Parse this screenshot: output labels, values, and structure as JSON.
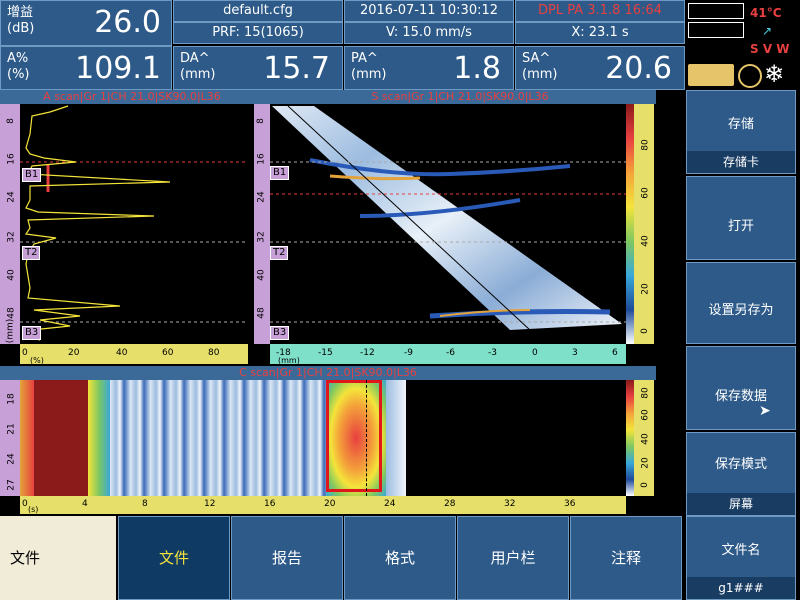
{
  "header": {
    "gain_label": "增益\n(dB)",
    "gain_value": "26.0",
    "file_name": "default.cfg",
    "prf": "PRF: 15(1065)",
    "datetime": "2016-07-11 10:30:12",
    "velocity": "V: 15.0 mm/s",
    "version": "DPL PA 3.1.8  16:64",
    "position": "X: 23.1  s",
    "amp_label": "A%\n(%)",
    "amp_value": "109.1",
    "da_label": "DA^\n(mm)",
    "da_value": "15.7",
    "pa_label": "PA^\n(mm)",
    "pa_value": "1.8",
    "sa_label": "SA^\n(mm)",
    "sa_value": "20.6"
  },
  "status": {
    "temperature": "41°C",
    "svw": "S V W"
  },
  "panels": {
    "ascan_title": "A scan|Gr 1|CH 21.0|SK90.0|L36",
    "sscan_title": "S scan|Gr 1|CH 21.0|SK90.0|L36",
    "cscan_title": "C scan|Gr 1|CH 21.0|SK90.0|L36",
    "unit_mm": "(mm)",
    "unit_pct": "(%)",
    "unit_s": "(s)",
    "marker_b1": "B1",
    "marker_t2": "T2",
    "marker_b3": "B3"
  },
  "ascan_y_ticks": [
    "8",
    "16",
    "24",
    "32",
    "40",
    "48"
  ],
  "ascan_x_ticks": [
    "0",
    "20",
    "40",
    "60",
    "80"
  ],
  "sscan_x_ticks": [
    "-18",
    "-15",
    "-12",
    "-9",
    "-6",
    "-3",
    "0",
    "3",
    "6"
  ],
  "sscan_y_ticks": [
    "8",
    "16",
    "24",
    "32",
    "40",
    "48"
  ],
  "sscan_color_ticks": [
    "80",
    "60",
    "40",
    "20",
    "0"
  ],
  "cscan_y_ticks": [
    "18",
    "21",
    "24",
    "27"
  ],
  "cscan_x_ticks": [
    "0",
    "4",
    "8",
    "12",
    "16",
    "20",
    "24",
    "28",
    "32",
    "36"
  ],
  "cscan_color_ticks": [
    "80",
    "60",
    "40",
    "20",
    "0"
  ],
  "side_menu": [
    {
      "label": "存储",
      "sub": "存储卡"
    },
    {
      "label": "打开",
      "sub": ""
    },
    {
      "label": "设置另存为",
      "sub": ""
    },
    {
      "label": "保存数据",
      "sub": ""
    },
    {
      "label": "保存模式",
      "sub": "屏幕"
    },
    {
      "label": "文件名",
      "sub": "g1###"
    }
  ],
  "bottom_tabs": {
    "menu_label": "文件",
    "tabs": [
      "文件",
      "报告",
      "格式",
      "用户栏",
      "注释"
    ]
  },
  "colors": {
    "header_bg": "#2d5a88",
    "active_tab": "#0f3a64",
    "active_tab_text": "#f4e43a",
    "title_red": "#e84040"
  }
}
